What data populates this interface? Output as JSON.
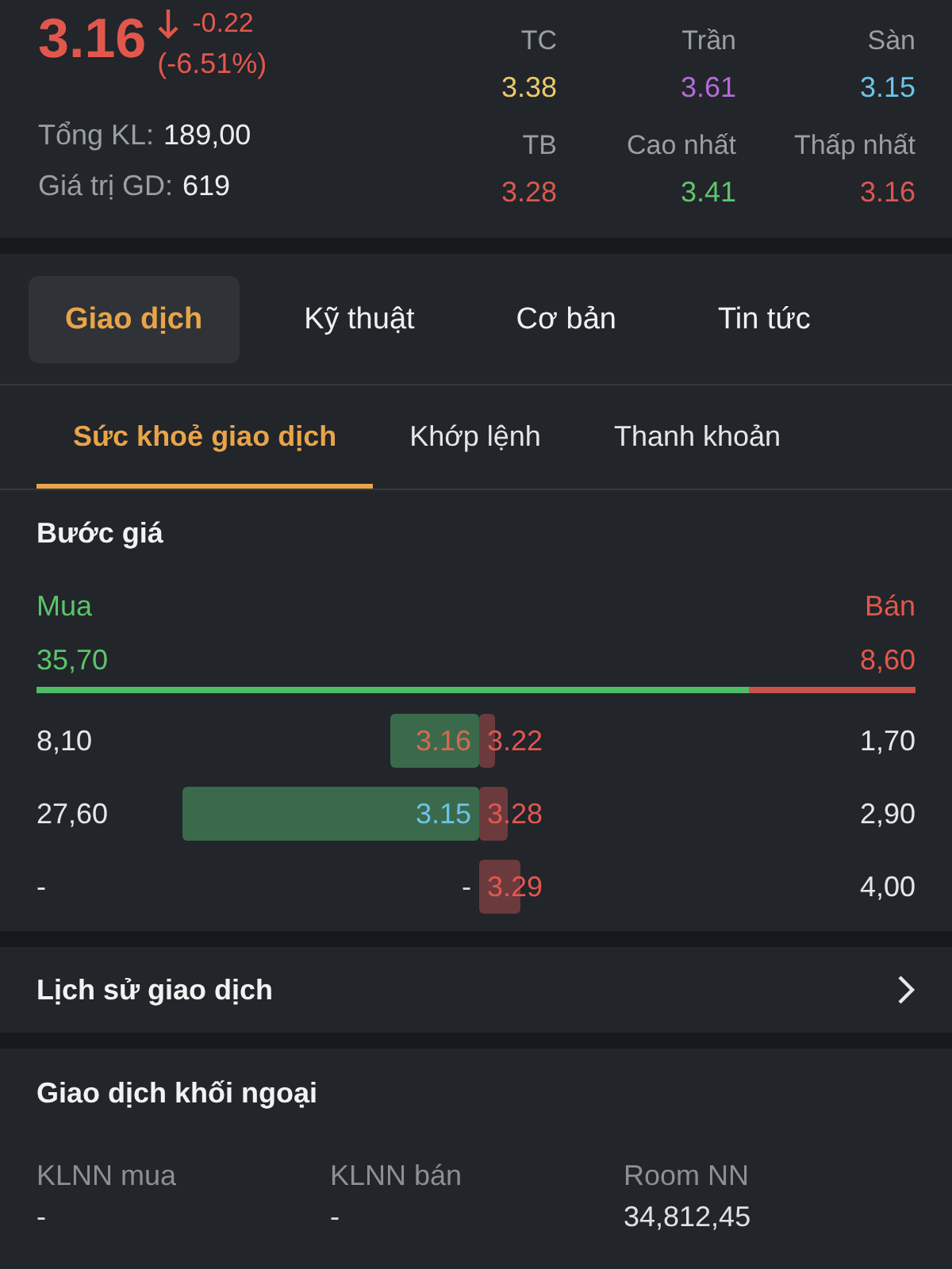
{
  "quote": {
    "price": "3.16",
    "falling": true,
    "change": "-0.22",
    "change_percent": "(-6.51%)",
    "total_volume": {
      "label": "Tổng KL:",
      "value": "189,00"
    },
    "trade_value": {
      "label": "Giá trị GD:",
      "value": "619"
    }
  },
  "reference_prices": [
    {
      "label": "TC",
      "value": "3.38",
      "color": "#e8c96a"
    },
    {
      "label": "Trần",
      "value": "3.61",
      "color": "#b46ad8"
    },
    {
      "label": "Sàn",
      "value": "3.15",
      "color": "#6cc3ea"
    },
    {
      "label": "TB",
      "value": "3.28",
      "color": "#d9584f"
    },
    {
      "label": "Cao nhất",
      "value": "3.41",
      "color": "#5fc46d"
    },
    {
      "label": "Thấp nhất",
      "value": "3.16",
      "color": "#d9584f"
    }
  ],
  "tabs": [
    {
      "label": "Giao dịch",
      "selected": true
    },
    {
      "label": "Kỹ thuật",
      "selected": false
    },
    {
      "label": "Cơ bản",
      "selected": false
    },
    {
      "label": "Tin tức",
      "selected": false
    }
  ],
  "sub_tabs": [
    {
      "label": "Sức khoẻ giao dịch",
      "selected": true
    },
    {
      "label": "Khớp lệnh",
      "selected": false
    },
    {
      "label": "Thanh khoản",
      "selected": false
    }
  ],
  "order_book": {
    "title": "Bước giá",
    "buy_label": "Mua",
    "sell_label": "Bán",
    "buy_total": "35,70",
    "sell_total": "8,60",
    "level": 0.81,
    "rows": [
      {
        "bid": {
          "volume": "8,10",
          "price": "3.16",
          "color": "#d8694f",
          "level": 0.2
        },
        "ask": {
          "price": "3.22",
          "color": "#e0574d",
          "level": 0.035,
          "volume": "1,70"
        }
      },
      {
        "bid": {
          "volume": "27,60",
          "price": "3.15",
          "color": "#6cc3ea",
          "level": 0.67
        },
        "ask": {
          "price": "3.28",
          "color": "#e0574d",
          "level": 0.066,
          "volume": "2,90"
        }
      },
      {
        "bid": {
          "volume": "-",
          "price": "-",
          "color": "#dcdcdc"
        },
        "ask": {
          "price": "3.29",
          "color": "#e0574d",
          "level": 0.095,
          "volume": "4,00"
        }
      }
    ]
  },
  "history": {
    "label": "Lịch sử giao dịch"
  },
  "foreign_trading": {
    "title": "Giao dịch khối ngoại",
    "stats": [
      {
        "label": "KLNN mua",
        "value": "-"
      },
      {
        "label": "KLNN bán",
        "value": "-"
      },
      {
        "label": "Room NN",
        "value": "34,812,45"
      }
    ]
  }
}
